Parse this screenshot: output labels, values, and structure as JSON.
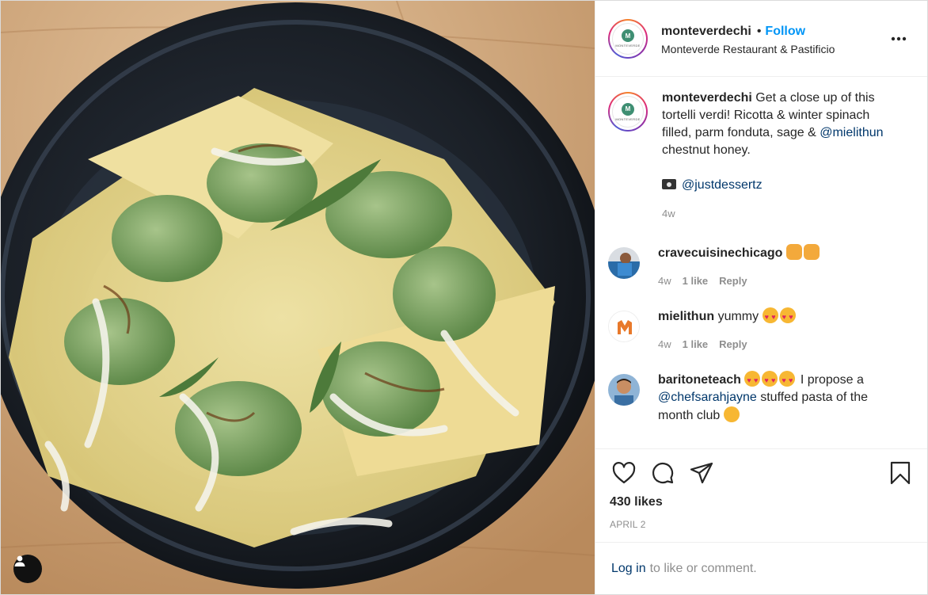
{
  "post": {
    "username": "monteverdechi",
    "dot": "•",
    "follow_label": "Follow",
    "location": "Monteverde Restaurant & Pastificio",
    "avatar_logo_text": "MONTEVERDE",
    "avatar_logo_mark": "M"
  },
  "caption": {
    "username": "monteverdechi",
    "text_1": "Get a close up of this tortelli verdi! Ricotta & winter spinach filled, parm fonduta, sage &",
    "mention": "@mielithun",
    "text_2": "chestnut honey.",
    "photo_credit": "@justdessertz",
    "time": "4w"
  },
  "comments": [
    {
      "username": "cravecuisinechicago",
      "text": "",
      "time": "4w",
      "likes": "1 like",
      "reply": "Reply",
      "emoji": "raising-hands"
    },
    {
      "username": "mielithun",
      "text": "yummy",
      "time": "4w",
      "likes": "1 like",
      "reply": "Reply",
      "emoji": "heart-eyes"
    },
    {
      "username": "baritoneteach",
      "text_1": "I propose a",
      "mention": "@chefsarahjayne",
      "text_2": "stuffed pasta of the month club",
      "emoji": "heart-eyes"
    }
  ],
  "actions": {
    "likes": "430 likes",
    "date": "APRIL 2",
    "icons": [
      "heart-icon",
      "comment-icon",
      "share-icon",
      "bookmark-icon"
    ]
  },
  "login": {
    "link": "Log in",
    "text": "to like or comment."
  },
  "colors": {
    "follow": "#0095f6",
    "mention": "#00376b",
    "muted": "#8e8e8e",
    "text": "#262626"
  }
}
